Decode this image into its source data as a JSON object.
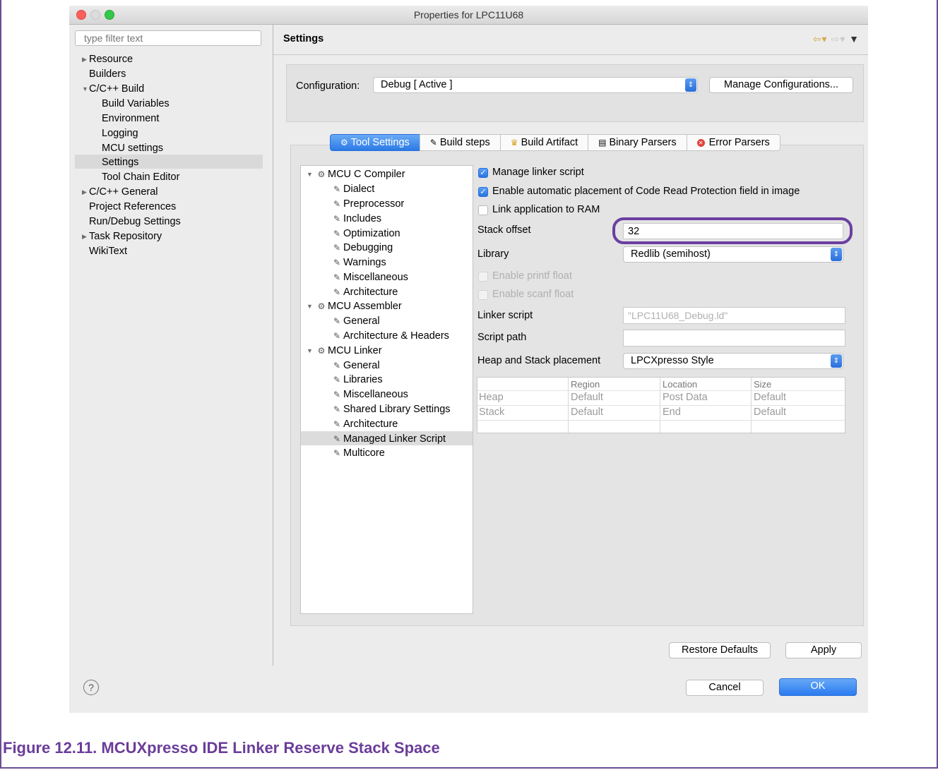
{
  "window": {
    "title": "Properties for LPC11U68"
  },
  "filter": {
    "placeholder": "type filter text"
  },
  "left_tree": [
    {
      "label": "Resource"
    },
    {
      "label": "Builders"
    },
    {
      "label": "C/C++ Build"
    },
    {
      "label": "Build Variables"
    },
    {
      "label": "Environment"
    },
    {
      "label": "Logging"
    },
    {
      "label": "MCU settings"
    },
    {
      "label": "Settings"
    },
    {
      "label": "Tool Chain Editor"
    },
    {
      "label": "C/C++ General"
    },
    {
      "label": "Project References"
    },
    {
      "label": "Run/Debug Settings"
    },
    {
      "label": "Task Repository"
    },
    {
      "label": "WikiText"
    }
  ],
  "header": {
    "title": "Settings"
  },
  "config": {
    "label": "Configuration:",
    "value": "Debug  [ Active ]",
    "manage_button": "Manage Configurations..."
  },
  "tabs": [
    {
      "label": "Tool Settings"
    },
    {
      "label": "Build steps"
    },
    {
      "label": "Build Artifact"
    },
    {
      "label": "Binary Parsers"
    },
    {
      "label": "Error Parsers"
    }
  ],
  "tool_tree": [
    {
      "label": "MCU C Compiler"
    },
    {
      "label": "Dialect"
    },
    {
      "label": "Preprocessor"
    },
    {
      "label": "Includes"
    },
    {
      "label": "Optimization"
    },
    {
      "label": "Debugging"
    },
    {
      "label": "Warnings"
    },
    {
      "label": "Miscellaneous"
    },
    {
      "label": "Architecture"
    },
    {
      "label": "MCU Assembler"
    },
    {
      "label": "General"
    },
    {
      "label": "Architecture & Headers"
    },
    {
      "label": "MCU Linker"
    },
    {
      "label": "General"
    },
    {
      "label": "Libraries"
    },
    {
      "label": "Miscellaneous"
    },
    {
      "label": "Shared Library Settings"
    },
    {
      "label": "Architecture"
    },
    {
      "label": "Managed Linker Script"
    },
    {
      "label": "Multicore"
    }
  ],
  "options": {
    "manage_linker_script": {
      "label": "Manage linker script",
      "checked": true
    },
    "auto_crp": {
      "label": "Enable automatic placement of Code Read Protection field in image",
      "checked": true
    },
    "link_to_ram": {
      "label": "Link application to RAM",
      "checked": false
    },
    "stack_offset": {
      "label": "Stack offset",
      "value": "32"
    },
    "library": {
      "label": "Library",
      "value": "Redlib (semihost)"
    },
    "printf_float": {
      "label": "Enable printf float",
      "checked": false
    },
    "scanf_float": {
      "label": "Enable scanf float",
      "checked": false
    },
    "linker_script": {
      "label": "Linker script",
      "placeholder": "\"LPC11U68_Debug.ld\""
    },
    "script_path": {
      "label": "Script path",
      "value": ""
    },
    "heap_stack": {
      "label": "Heap and Stack placement",
      "value": "LPCXpresso Style"
    }
  },
  "heap_table": {
    "columns": [
      "Region",
      "Location",
      "Size"
    ],
    "rows": [
      {
        "name": "Heap",
        "region": "Default",
        "location": "Post Data",
        "size": "Default"
      },
      {
        "name": "Stack",
        "region": "Default",
        "location": "End",
        "size": "Default"
      }
    ]
  },
  "buttons": {
    "restore": "Restore Defaults",
    "apply": "Apply",
    "cancel": "Cancel",
    "ok": "OK"
  },
  "caption": "Figure 12.11. MCUXpresso IDE Linker Reserve Stack Space",
  "colors": {
    "accent": "#2b7ae6",
    "highlight": "#6b3fa0",
    "caption": "#6a3d9a"
  }
}
